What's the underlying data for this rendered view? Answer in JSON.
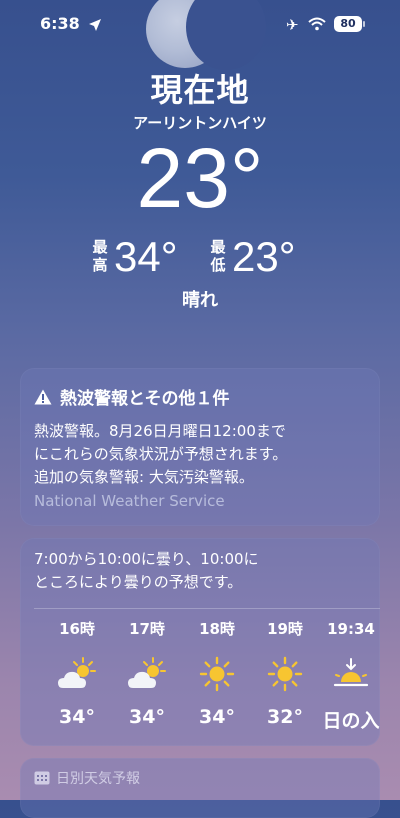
{
  "status_bar": {
    "time": "6:38",
    "battery": "80"
  },
  "location": {
    "title": "現在地",
    "subtitle": "アーリントンハイツ",
    "temperature": "23°",
    "high_label": "最高",
    "high_value": "34°",
    "low_label": "最低",
    "low_value": "23°",
    "condition": "晴れ"
  },
  "alert": {
    "title": "熱波警報とその他１件",
    "line1": "熱波警報。8月26日月曜日12:00まで",
    "line2": "にこれらの気象状況が予想されます。",
    "line3": "追加の気象警報: 大気汚染警報。",
    "source": "National Weather Service"
  },
  "hourly": {
    "summary_line1": "7:00から10:00に曇り、10:00に",
    "summary_line2": "ところにより曇りの予想です。",
    "items": [
      {
        "time": "16時",
        "icon": "partly-cloudy-icon",
        "temp": "34°"
      },
      {
        "time": "17時",
        "icon": "partly-cloudy-icon",
        "temp": "34°"
      },
      {
        "time": "18時",
        "icon": "sun-icon",
        "temp": "34°"
      },
      {
        "time": "19時",
        "icon": "sun-icon",
        "temp": "32°"
      },
      {
        "time": "19:34",
        "icon": "sunset-icon",
        "temp": "日の入"
      }
    ]
  },
  "daily": {
    "label": "日別天気予報",
    "icon": "calendar-icon"
  },
  "colors": {
    "sun": "#f7c531",
    "cloud": "#f2f4f8",
    "background_top": "#37508e",
    "background_bottom": "#a98cb0"
  }
}
